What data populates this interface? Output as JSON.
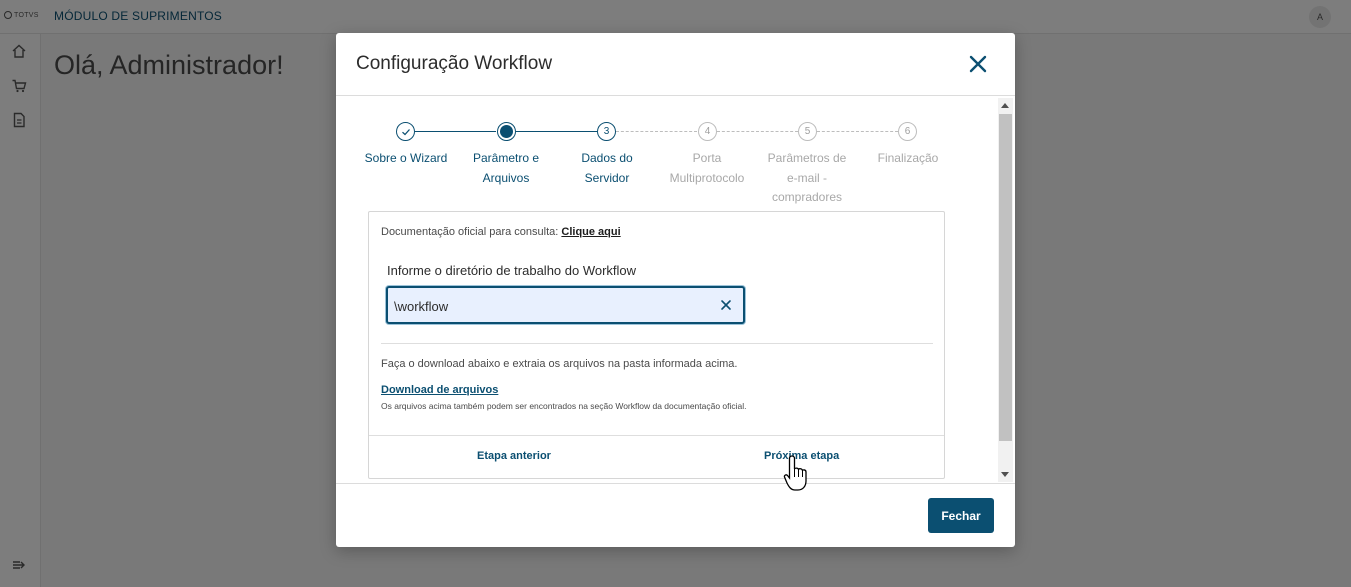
{
  "app": {
    "logo": "TOTVS",
    "module_title": "MÓDULO DE SUPRIMENTOS",
    "greeting": "Olá, Administrador!",
    "user_initial": "A",
    "sidebar": [
      {
        "icon": "home-icon"
      },
      {
        "icon": "cart-icon"
      },
      {
        "icon": "document-icon"
      }
    ],
    "collapse_icon": "expand-sidebar-icon"
  },
  "modal": {
    "title": "Configuração Workflow",
    "close_icon": "close-icon",
    "steps": [
      {
        "number": "",
        "label_lines": [
          "Sobre o Wizard"
        ],
        "state": "done"
      },
      {
        "number": "",
        "label_lines": [
          "Parâmetro e",
          "Arquivos"
        ],
        "state": "current"
      },
      {
        "number": "3",
        "label_lines": [
          "Dados do",
          "Servidor"
        ],
        "state": "next"
      },
      {
        "number": "4",
        "label_lines": [
          "Porta",
          "Multiprotocolo"
        ],
        "state": "pending"
      },
      {
        "number": "5",
        "label_lines": [
          "Parâmetros de",
          "e-mail -",
          "compradores"
        ],
        "state": "pending"
      },
      {
        "number": "6",
        "label_lines": [
          "Finalização"
        ],
        "state": "pending"
      }
    ],
    "doc_text": "Documentação oficial para consulta:",
    "doc_link": "Clique aqui",
    "field_label": "Informe o diretório de trabalho do Workflow",
    "field_value": "\\workflow",
    "download_text": "Faça o download abaixo e extraia os arquivos na pasta informada acima.",
    "download_link": "Download de arquivos",
    "download_note": "Os arquivos acima também podem ser encontrados na seção Workflow da documentação oficial.",
    "prev_button": "Etapa anterior",
    "next_button": "Próxima etapa",
    "close_button": "Fechar"
  },
  "colors": {
    "primary": "#0b4f71",
    "inactive": "#a8a8a8"
  }
}
